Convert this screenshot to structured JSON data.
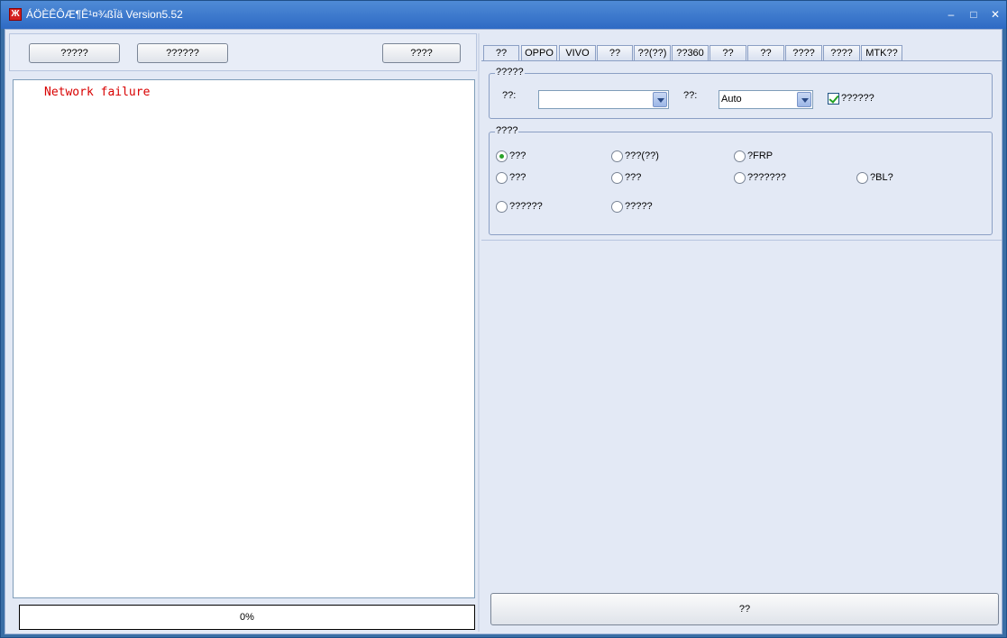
{
  "window": {
    "title": "ÁÖÈÊÔÆ¶Ê¹¤¾ßÏä Version5.52",
    "icon": "app-logo-icon",
    "minimize_label": "–",
    "maximize_label": "□",
    "close_label": "✕"
  },
  "left": {
    "toolbar": {
      "btn1_label": "?????",
      "btn2_label": "??????",
      "btn3_label": "????"
    },
    "log": {
      "lines": [
        "Network failure"
      ]
    },
    "progress": {
      "value_label": "0%",
      "value": 0
    }
  },
  "tabs": [
    "??",
    "OPPO",
    "VIVO",
    "??",
    "??(??)",
    "??360",
    "??",
    "??",
    "????",
    "????",
    "MTK??"
  ],
  "group1": {
    "title": "?????",
    "field1_label": "??:",
    "field1_value": "",
    "field2_label": "??:",
    "field2_value": "Auto",
    "checkbox_label": "??????",
    "checkbox_checked": true
  },
  "group2": {
    "title": "????",
    "options": [
      "???",
      "???(??)",
      "?FRP",
      "???",
      "???",
      "???????",
      "?BL?",
      "??????",
      "?????"
    ],
    "selected_index": 0
  },
  "bottom_button_label": "??",
  "colors": {
    "log_error": "#d80000",
    "title_bar": "#2e6ac4",
    "radio_checked": "#2aa22a"
  }
}
